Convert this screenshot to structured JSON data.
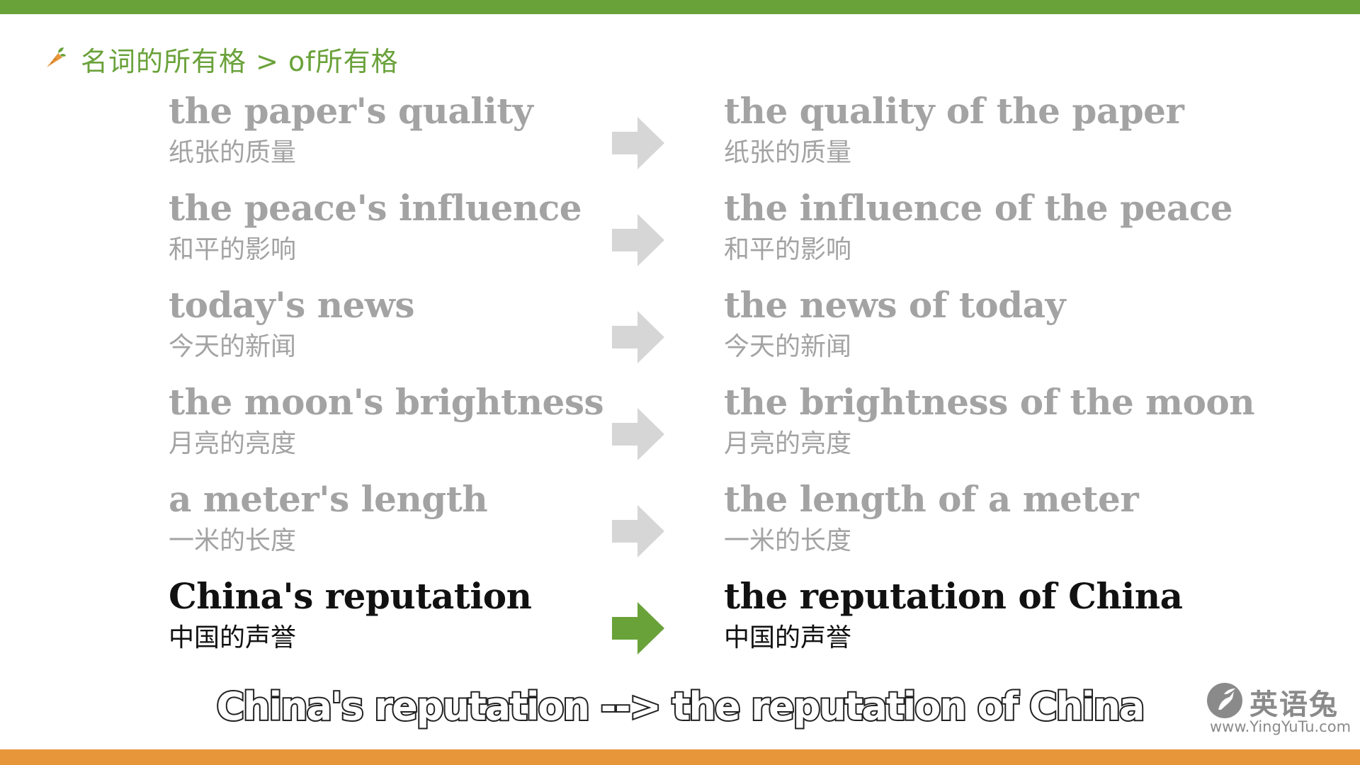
{
  "breadcrumb": {
    "icon": "carrot-icon",
    "text": "名词的所有格 > of所有格"
  },
  "rows": [
    {
      "left_en": "the paper's quality",
      "left_zh": "纸张的质量",
      "right_en": "the quality of the paper",
      "right_zh": "纸张的质量",
      "active": false
    },
    {
      "left_en": "the peace's influence",
      "left_zh": "和平的影响",
      "right_en": "the influence of the peace",
      "right_zh": "和平的影响",
      "active": false
    },
    {
      "left_en": "today's news",
      "left_zh": "今天的新闻",
      "right_en": "the news of today",
      "right_zh": "今天的新闻",
      "active": false
    },
    {
      "left_en": "the moon's brightness",
      "left_zh": "月亮的亮度",
      "right_en": "the brightness of the moon",
      "right_zh": "月亮的亮度",
      "active": false
    },
    {
      "left_en": "a meter's length",
      "left_zh": "一米的长度",
      "right_en": "the length of a meter",
      "right_zh": "一米的长度",
      "active": false
    },
    {
      "left_en": "China's reputation",
      "left_zh": "中国的声誉",
      "right_en": "the reputation of China",
      "right_zh": "中国的声誉",
      "active": true
    }
  ],
  "subtitle": "China's reputation --> the reputation of China",
  "watermark": {
    "name": "英语兔",
    "url": "www.YingYuTu.com"
  },
  "colors": {
    "accent_green": "#6aa23a",
    "accent_orange": "#e8963a",
    "faded_text": "#a3a3a3",
    "faded_arrow": "#d6d6d6",
    "active_text": "#111111"
  }
}
